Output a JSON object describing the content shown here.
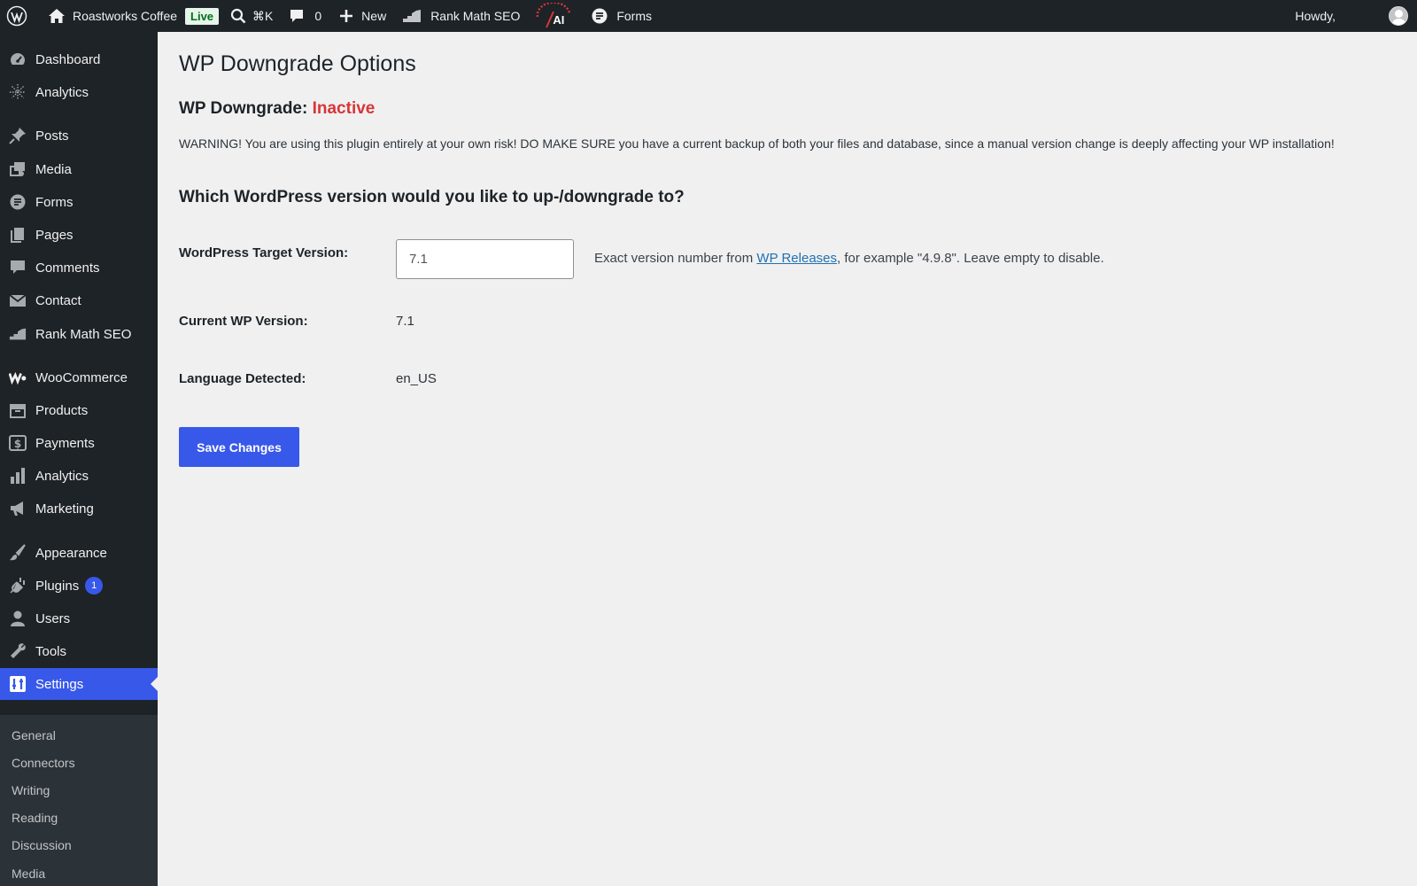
{
  "adminbar": {
    "site_name": "Roastworks Coffee",
    "live_badge": "Live",
    "search_shortcut": "⌘K",
    "comments_count": "0",
    "new_label": "New",
    "rankmath_label": "Rank Math SEO",
    "ai_label": "AI",
    "forms_label": "Forms",
    "howdy": "Howdy,"
  },
  "sidebar": {
    "items": [
      {
        "label": "Dashboard",
        "icon": "dashboard-icon"
      },
      {
        "label": "Analytics",
        "icon": "analytics-sparkle-icon"
      },
      {
        "label": "Posts",
        "icon": "pin-icon"
      },
      {
        "label": "Media",
        "icon": "media-icon"
      },
      {
        "label": "Forms",
        "icon": "forms-icon"
      },
      {
        "label": "Pages",
        "icon": "pages-icon"
      },
      {
        "label": "Comments",
        "icon": "comment-icon"
      },
      {
        "label": "Contact",
        "icon": "envelope-icon"
      },
      {
        "label": "Rank Math SEO",
        "icon": "rankmath-icon"
      },
      {
        "label": "WooCommerce",
        "icon": "woocommerce-icon"
      },
      {
        "label": "Products",
        "icon": "products-icon"
      },
      {
        "label": "Payments",
        "icon": "dollar-icon"
      },
      {
        "label": "Analytics",
        "icon": "bar-chart-icon"
      },
      {
        "label": "Marketing",
        "icon": "megaphone-icon"
      },
      {
        "label": "Appearance",
        "icon": "brush-icon"
      },
      {
        "label": "Plugins",
        "icon": "plug-icon",
        "badge": "1"
      },
      {
        "label": "Users",
        "icon": "user-icon"
      },
      {
        "label": "Tools",
        "icon": "wrench-icon"
      },
      {
        "label": "Settings",
        "icon": "settings-icon"
      }
    ],
    "submenu": [
      "General",
      "Connectors",
      "Writing",
      "Reading",
      "Discussion",
      "Media"
    ]
  },
  "main": {
    "title": "WP Downgrade Options",
    "status_prefix": "WP Downgrade:",
    "status_value": "Inactive",
    "warning": "WARNING! You are using this plugin entirely at your own risk! DO MAKE SURE you have a current backup of both your files and database, since a manual version change is deeply affecting your WP installation!",
    "question": "Which WordPress version would you like to up-/downgrade to?",
    "target_label": "WordPress Target Version:",
    "target_value": "7.1",
    "help_prefix": "Exact version number from ",
    "help_link": "WP Releases",
    "help_suffix": ", for example \"4.9.8\". Leave empty to disable.",
    "current_label": "Current WP Version:",
    "current_value": "7.1",
    "language_label": "Language Detected:",
    "language_value": "en_US",
    "save_label": "Save Changes"
  },
  "colors": {
    "accent": "#3858e9",
    "inactive": "#d63638",
    "sidebar_bg": "#1d2327"
  }
}
